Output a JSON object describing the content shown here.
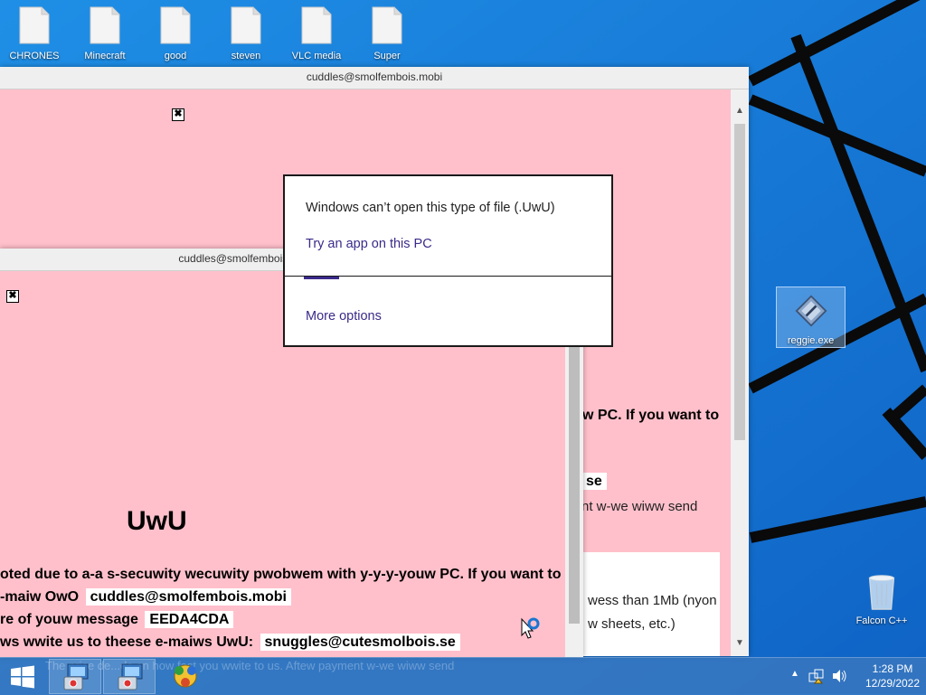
{
  "desktop": {
    "icons_top": [
      {
        "label": "CHRONES"
      },
      {
        "label": "Minecraft"
      },
      {
        "label": "good"
      },
      {
        "label": "steven"
      },
      {
        "label": "VLC media"
      },
      {
        "label": "Super"
      }
    ],
    "icon_reggie": {
      "label": "reggie.exe"
    },
    "icon_recycle": {
      "label": "Falcon C++"
    }
  },
  "window_back": {
    "title": "cuddles@smolfembois.mobi",
    "close_glyph": "✖",
    "peek_lines": [
      "w PC. If you want to",
      "se",
      "nt w-we wiww send",
      "wess than 1Mb (nyon",
      "w sheets, etc.)"
    ]
  },
  "window_front": {
    "title": "cuddles@smolfembois.mobi",
    "close_glyph": "✖",
    "heading": "UwU",
    "line1": "oted due to a-a s-secuwity wecuwity pwobwem with y-y-y-youw PC. If you want to",
    "line2_prefix": "-maiw OwO",
    "line2_chip": "cuddles@smolfembois.mobi",
    "line3_prefix": "re of youw message",
    "line3_chip": "EEDA4CDA",
    "line4_prefix": "ws wwite us to theese e-maiws UwU:",
    "line4_chip": "snuggles@cutesmolbois.se"
  },
  "dialog": {
    "message": "Windows can’t open this type of file (.UwU)",
    "try_app": "Try an app on this PC",
    "more_options": "More options"
  },
  "taskbar": {
    "ghost_text": "The price de...ds on how fast you wwite to us. Aftew payment w-we wiww send",
    "clock_time": "1:28 PM",
    "clock_date": "12/29/2022"
  }
}
